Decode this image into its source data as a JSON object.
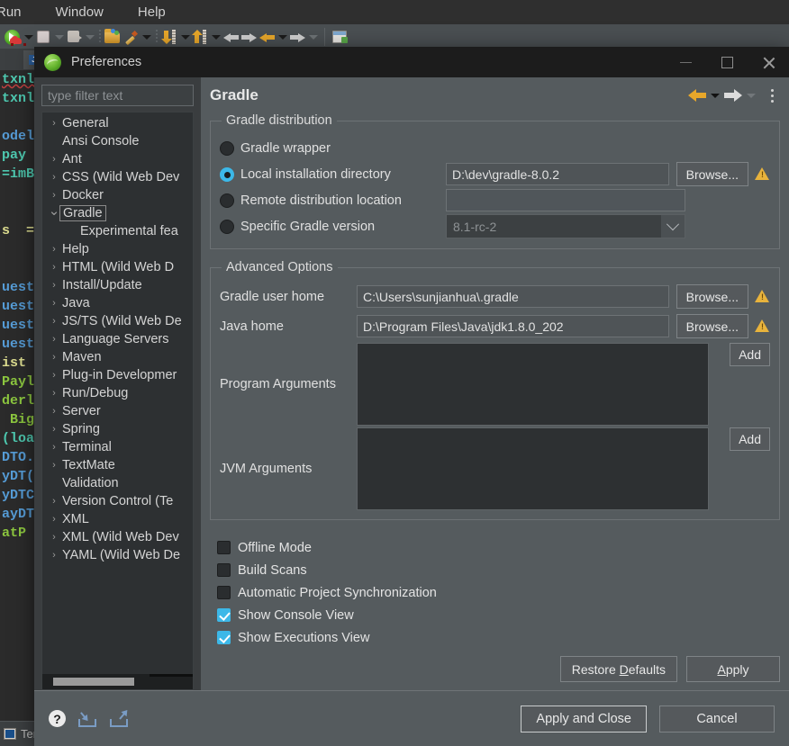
{
  "ide": {
    "menu": [
      "Run",
      "Window",
      "Help"
    ],
    "tab_label": "J",
    "status_text": "Ter",
    "code_lines": [
      {
        "text": "txnlo",
        "color": "cyan",
        "squiggle": true
      },
      {
        "text": "txnlo",
        "color": "cyan",
        "squiggle": false
      },
      {
        "text": "",
        "color": "cyan",
        "squiggle": false
      },
      {
        "text": "odel",
        "color": "blue",
        "squiggle": false
      },
      {
        "text": "pay",
        "color": "cyan",
        "squiggle": false
      },
      {
        "text": "=imB",
        "color": "cyan",
        "squiggle": false
      },
      {
        "text": "",
        "color": "cyan",
        "squiggle": false
      },
      {
        "text": "",
        "color": "cyan",
        "squiggle": false
      },
      {
        "text": "s  =",
        "color": "yellow",
        "squiggle": false
      },
      {
        "text": "",
        "color": "cyan",
        "squiggle": false
      },
      {
        "text": "",
        "color": "cyan",
        "squiggle": false
      },
      {
        "text": "uest",
        "color": "blue",
        "squiggle": false
      },
      {
        "text": "uest",
        "color": "blue",
        "squiggle": false
      },
      {
        "text": "uest",
        "color": "blue",
        "squiggle": false
      },
      {
        "text": "uest",
        "color": "blue",
        "squiggle": false
      },
      {
        "text": "ist =",
        "color": "yellow",
        "squiggle": false
      },
      {
        "text": "Paylo",
        "color": "lgreen",
        "squiggle": false
      },
      {
        "text": "derl",
        "color": "lgreen",
        "squiggle": false
      },
      {
        "text": " Bigl",
        "color": "lgreen",
        "squiggle": false
      },
      {
        "text": "(loan",
        "color": "cyan",
        "squiggle": false
      },
      {
        "text": "DTO.",
        "color": "blue",
        "squiggle": false
      },
      {
        "text": "yDT(",
        "color": "blue",
        "squiggle": false
      },
      {
        "text": "yDTC",
        "color": "blue",
        "squiggle": false
      },
      {
        "text": "ayDT",
        "color": "blue",
        "squiggle": false
      },
      {
        "text": "atP",
        "color": "lgreen",
        "squiggle": false
      }
    ]
  },
  "dialog": {
    "title": "Preferences",
    "window_controls": {
      "minimize": "minimize",
      "maximize": "maximize",
      "close": "close"
    },
    "filter_placeholder": "type filter text",
    "tree_items": [
      {
        "label": "General",
        "expandable": true,
        "expanded": false,
        "selected": false,
        "child": false
      },
      {
        "label": "Ansi Console",
        "expandable": false,
        "expanded": false,
        "selected": false,
        "child": false
      },
      {
        "label": "Ant",
        "expandable": true,
        "expanded": false,
        "selected": false,
        "child": false
      },
      {
        "label": "CSS (Wild Web Dev",
        "expandable": true,
        "expanded": false,
        "selected": false,
        "child": false
      },
      {
        "label": "Docker",
        "expandable": true,
        "expanded": false,
        "selected": false,
        "child": false
      },
      {
        "label": "Gradle",
        "expandable": true,
        "expanded": true,
        "selected": true,
        "child": false
      },
      {
        "label": "Experimental fea",
        "expandable": false,
        "expanded": false,
        "selected": false,
        "child": true
      },
      {
        "label": "Help",
        "expandable": true,
        "expanded": false,
        "selected": false,
        "child": false
      },
      {
        "label": "HTML (Wild Web D",
        "expandable": true,
        "expanded": false,
        "selected": false,
        "child": false
      },
      {
        "label": "Install/Update",
        "expandable": true,
        "expanded": false,
        "selected": false,
        "child": false
      },
      {
        "label": "Java",
        "expandable": true,
        "expanded": false,
        "selected": false,
        "child": false
      },
      {
        "label": "JS/TS (Wild Web De",
        "expandable": true,
        "expanded": false,
        "selected": false,
        "child": false
      },
      {
        "label": "Language Servers",
        "expandable": true,
        "expanded": false,
        "selected": false,
        "child": false
      },
      {
        "label": "Maven",
        "expandable": true,
        "expanded": false,
        "selected": false,
        "child": false
      },
      {
        "label": "Plug-in Developmer",
        "expandable": true,
        "expanded": false,
        "selected": false,
        "child": false
      },
      {
        "label": "Run/Debug",
        "expandable": true,
        "expanded": false,
        "selected": false,
        "child": false
      },
      {
        "label": "Server",
        "expandable": true,
        "expanded": false,
        "selected": false,
        "child": false
      },
      {
        "label": "Spring",
        "expandable": true,
        "expanded": false,
        "selected": false,
        "child": false
      },
      {
        "label": "Terminal",
        "expandable": true,
        "expanded": false,
        "selected": false,
        "child": false
      },
      {
        "label": "TextMate",
        "expandable": true,
        "expanded": false,
        "selected": false,
        "child": false
      },
      {
        "label": "Validation",
        "expandable": false,
        "expanded": false,
        "selected": false,
        "child": false
      },
      {
        "label": "Version Control (Te",
        "expandable": true,
        "expanded": false,
        "selected": false,
        "child": false
      },
      {
        "label": "XML",
        "expandable": true,
        "expanded": false,
        "selected": false,
        "child": false
      },
      {
        "label": "XML (Wild Web Dev",
        "expandable": true,
        "expanded": false,
        "selected": false,
        "child": false
      },
      {
        "label": "YAML (Wild Web De",
        "expandable": true,
        "expanded": false,
        "selected": false,
        "child": false
      }
    ],
    "page_title": "Gradle",
    "distribution": {
      "legend": "Gradle distribution",
      "wrapper_label": "Gradle wrapper",
      "local_label": "Local installation directory",
      "local_value": "D:\\dev\\gradle-8.0.2",
      "local_browse": "Browse...",
      "remote_label": "Remote distribution location",
      "remote_value": "",
      "version_label": "Specific Gradle version",
      "version_value": "8.1-rc-2",
      "selected": "local"
    },
    "advanced": {
      "legend": "Advanced Options",
      "gradle_user_home_label": "Gradle user home",
      "gradle_user_home_value": "C:\\Users\\sunjianhua\\.gradle",
      "gradle_user_home_browse": "Browse...",
      "java_home_label": "Java home",
      "java_home_value": "D:\\Program Files\\Java\\jdk1.8.0_202",
      "java_home_browse": "Browse...",
      "program_args_label": "Program Arguments",
      "program_args_value": "",
      "program_args_add": "Add",
      "jvm_args_label": "JVM Arguments",
      "jvm_args_value": "",
      "jvm_args_add": "Add"
    },
    "checkboxes": [
      {
        "label": "Offline Mode",
        "checked": false
      },
      {
        "label": "Build Scans",
        "checked": false
      },
      {
        "label": "Automatic Project Synchronization",
        "checked": false
      },
      {
        "label": "Show Console View",
        "checked": true
      },
      {
        "label": "Show Executions View",
        "checked": true
      }
    ],
    "buttons": {
      "restore_defaults_prefix": "Restore ",
      "restore_defaults_mnemonic": "D",
      "restore_defaults_suffix": "efaults",
      "apply_mnemonic": "A",
      "apply_suffix": "pply",
      "apply_and_close": "Apply and Close",
      "cancel": "Cancel"
    },
    "footer_icons": {
      "help": "?",
      "import": "import-icon",
      "export": "export-icon"
    }
  },
  "colors": {
    "accent": "#3cb8e8",
    "warning": "#e8b33c",
    "dialog_bg": "#555b5e",
    "titlebar_bg": "#1c1c1c",
    "tree_bg": "#2d3032"
  }
}
